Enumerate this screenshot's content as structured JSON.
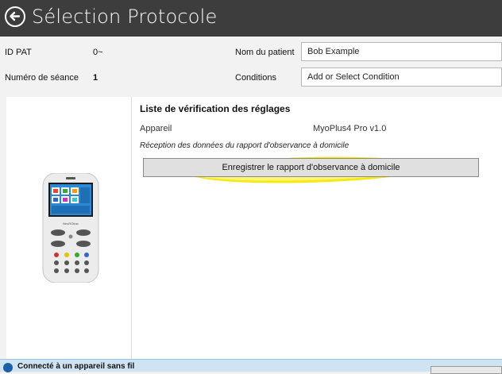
{
  "header": {
    "title": "Sélection Protocole",
    "back_icon": "back-arrow-icon"
  },
  "patient": {
    "id_label": "ID PAT",
    "id_value": "0~",
    "name_label": "Nom du patient",
    "name_value": "Bob Example",
    "session_label": "Numéro de séance",
    "session_value": "1",
    "conditions_label": "Conditions",
    "conditions_value": "Add or Select Condition"
  },
  "checklist": {
    "title": "Liste de vérification des réglages",
    "device_label": "Appareil",
    "device_value": "MyoPlus4 Pro v1.0",
    "reception_text": "Réception des données du rapport d'observance à domicile",
    "report_button": "Enregistrer le rapport d'observance à domicile"
  },
  "device_image": {
    "brand": "NeuROtrac"
  },
  "status": {
    "text": "Connecté à un appareil sans fil",
    "icon": "info-icon"
  },
  "colors": {
    "titlebar": "#3d3d3d",
    "highlight": "#fff000",
    "statusbar": "#cfe3f3"
  }
}
